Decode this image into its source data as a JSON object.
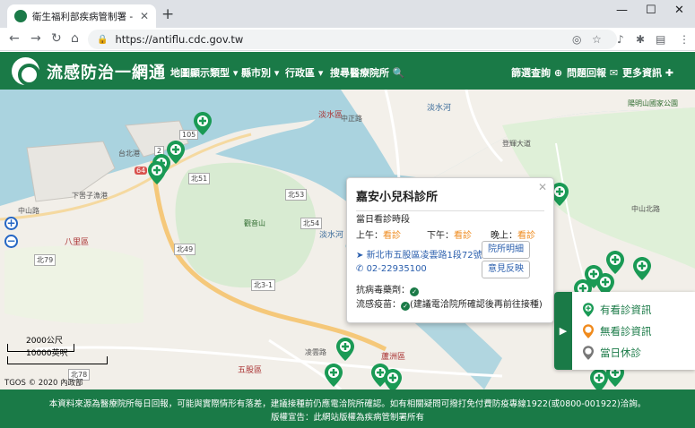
{
  "browser": {
    "tab_title": "衛生福利部疾病管制署 - 流感防治",
    "url": "https://antiflu.cdc.gov.tw"
  },
  "header": {
    "brand": "流感防治一網通",
    "nav": [
      {
        "label": "地圖顯示類型 ▾"
      },
      {
        "label": "縣市別 ▾"
      },
      {
        "label": "行政區 ▾"
      },
      {
        "label": "搜尋醫療院所 🔍"
      }
    ],
    "right_nav": [
      {
        "label": "篩選查詢 ⊕"
      },
      {
        "label": "問題回報 ✉"
      },
      {
        "label": "更多資訊 ✚"
      }
    ]
  },
  "map": {
    "labels": [
      {
        "text": "淡水區"
      },
      {
        "text": "淡水河"
      },
      {
        "text": "淡水河"
      },
      {
        "text": "中正路"
      },
      {
        "text": "登輝大道"
      },
      {
        "text": "中山北路"
      },
      {
        "text": "陽明山國家公園"
      },
      {
        "text": "八里區"
      },
      {
        "text": "觀音山"
      },
      {
        "text": "下罟子漁港"
      },
      {
        "text": "台北港"
      },
      {
        "text": "五股區"
      },
      {
        "text": "蘆洲區"
      },
      {
        "text": "凌雲路"
      },
      {
        "text": "中山路"
      },
      {
        "text": "北51"
      },
      {
        "text": "北53"
      },
      {
        "text": "北54"
      },
      {
        "text": "北49"
      },
      {
        "text": "北79"
      },
      {
        "text": "北3-1"
      },
      {
        "text": "北78"
      },
      {
        "text": "64"
      },
      {
        "text": "105"
      },
      {
        "text": "2"
      }
    ],
    "scale_metric": "2000公尺",
    "scale_imperial": "10000英呎",
    "attribution": "TGOS © 2020 內政部"
  },
  "popup": {
    "name": "嘉安小兒科診所",
    "section": "當日看診時段",
    "morning_label": "上午：",
    "morning": "看診",
    "afternoon_label": "下午：",
    "afternoon": "看診",
    "evening_label": "晚上：",
    "evening": "看診",
    "address": "新北市五股區凌雲路1段72號",
    "phone": "02-22935100",
    "btn_clinic": "院所明細",
    "btn_feedback": "意見反映",
    "antiviral_label": "抗病毒藥劑：",
    "vaccine_label": "流感疫苗：",
    "vaccine_note": "(建議電洽院所確認後再前往接種)"
  },
  "legend": {
    "items": [
      {
        "label": "有看診資訊",
        "color": "#1a9a55"
      },
      {
        "label": "無看診資訊",
        "color": "#f08a1c"
      },
      {
        "label": "當日休診",
        "color": "#777777"
      }
    ]
  },
  "footer": {
    "line1": "本資料來源為醫療院所每日回報，可能與實際情形有落差，建議接種前仍應電洽院所確認。如有相關疑問可撥打免付費防疫專線1922(或0800-001922)洽詢。",
    "line2": "版權宣告：此網站版權為疾病管制署所有"
  }
}
